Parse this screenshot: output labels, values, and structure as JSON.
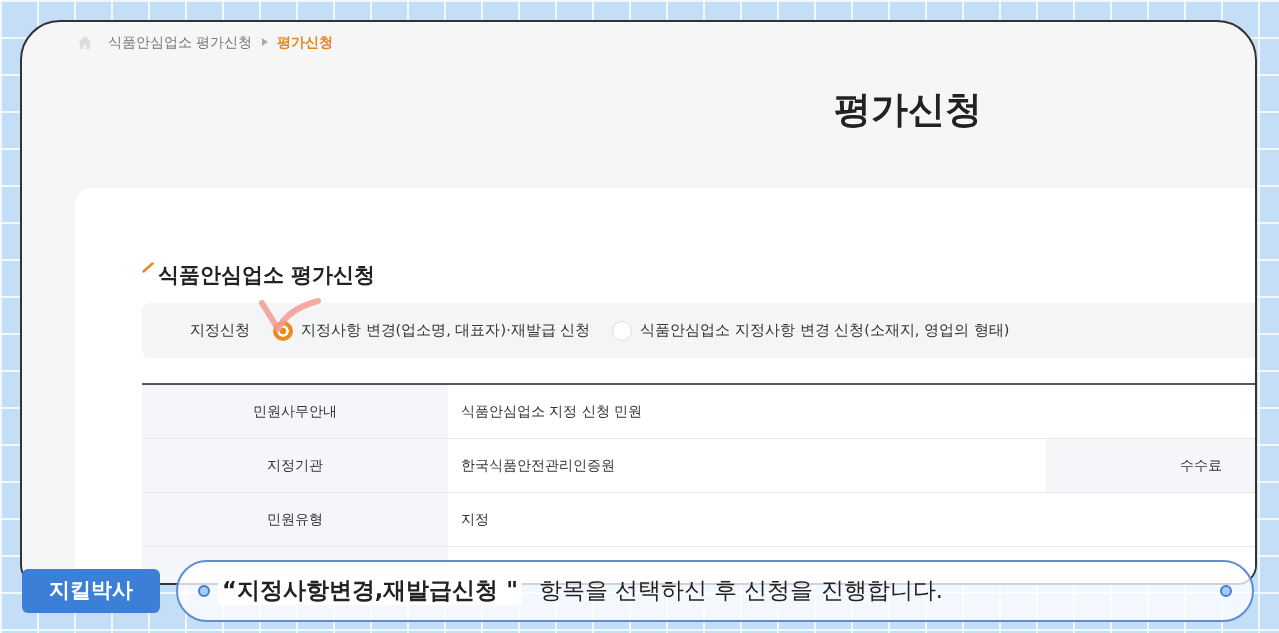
{
  "breadcrumb": [
    {
      "label": "식품안심업소 평가신청",
      "current": false
    },
    {
      "label": "평가신청",
      "current": true
    }
  ],
  "page_title": "평가신청",
  "section_title": "식품안심업소 평가신청",
  "designation": {
    "label": "지정신청",
    "options": [
      {
        "label": "지정사항 변경(업소명, 대표자)·재발급 신청",
        "selected": true
      },
      {
        "label": "식품안심업소 지정사항 변경 신청(소재지, 영업의 형태)",
        "selected": false
      }
    ]
  },
  "info_table": {
    "rows": [
      {
        "label": "민원사무안내",
        "value": "식품안심업소 지정 신청 민원"
      },
      {
        "label": "지정기관",
        "value": "한국식품안전관리인증원",
        "extra_label": "수수료"
      },
      {
        "label": "민원유형",
        "value": "지정"
      }
    ]
  },
  "caption": {
    "speaker": "지킬박사",
    "text": "**“지정사항변경,재발급신청 \"** 항목을 선택하신 후 신청을 진행합니다."
  }
}
